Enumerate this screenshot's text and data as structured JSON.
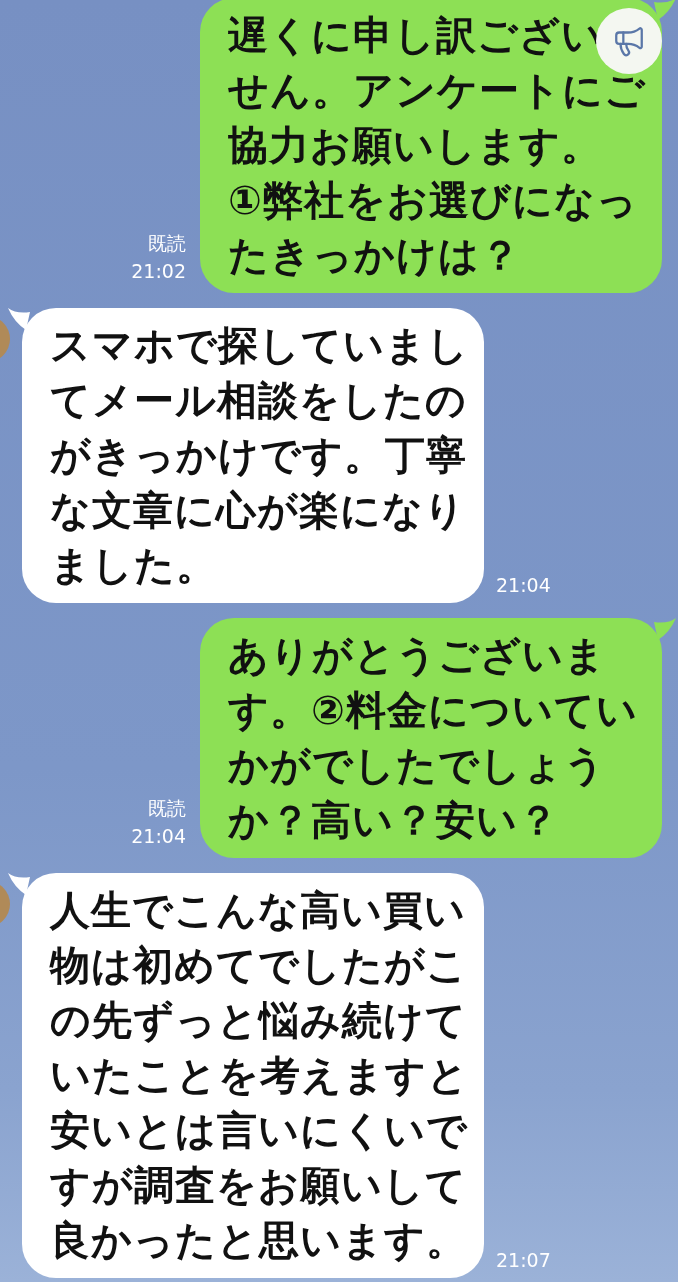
{
  "messages": [
    {
      "kind": "sent",
      "paragraphs": [
        "遅くに申し訳ござい",
        "せん。アンケートにご協力お願いします。",
        "①弊社をお選びになったきっかけは？"
      ],
      "read": "既読",
      "time": "21:02"
    },
    {
      "kind": "received",
      "paragraphs": [
        "スマホで探していましてメール相談をしたのがきっかけです。丁寧な文章に心が楽になりました。"
      ],
      "time": "21:04"
    },
    {
      "kind": "sent",
      "paragraphs": [
        "ありがとうございます。②料金についていかがでしたでしょうか？高い？安い？"
      ],
      "read": "既読",
      "time": "21:04"
    },
    {
      "kind": "received",
      "paragraphs": [
        "人生でこんな高い買い物は初めてでしたがこの先ずっと悩み続けていたことを考えますと安いとは言いにくいですが調査をお願いして良かったと思います。"
      ],
      "time": "21:07"
    }
  ]
}
